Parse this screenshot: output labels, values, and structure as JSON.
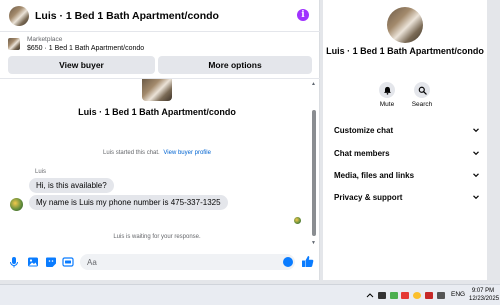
{
  "header": {
    "title": "Luis · 1 Bed 1 Bath Apartment/condo",
    "info_icon": "info-icon",
    "info_glyph": "i"
  },
  "marketplace": {
    "label": "Marketplace",
    "listing": "$650 · 1 Bed 1 Bath Apartment/condo"
  },
  "actions": {
    "view_buyer": "View buyer",
    "more_options": "More options"
  },
  "thread": {
    "title": "Luis · 1 Bed 1 Bath Apartment/condo",
    "started_text": "Luis started this chat.",
    "started_link": "View buyer profile",
    "sender_name": "Luis",
    "messages": [
      "Hi, is this available?",
      "My name is Luis my phone number is 475-337-1325"
    ],
    "waiting_text": "Luis is waiting for your response."
  },
  "composer": {
    "placeholder": "Aa",
    "icons": [
      "microphone-icon",
      "image-icon",
      "sticker-icon",
      "gif-icon",
      "emoji-icon",
      "like-icon"
    ],
    "accent": "#0a7cff"
  },
  "panel": {
    "title": "Luis · 1 Bed 1 Bath Apartment/condo",
    "mute_label": "Mute",
    "search_label": "Search",
    "sections": [
      "Customize chat",
      "Chat members",
      "Media, files and links",
      "Privacy & support"
    ]
  },
  "taskbar": {
    "language": "ENG",
    "time": "9:07 PM",
    "date": "12/23/2025"
  },
  "colors": {
    "info_purple": "#a033ff",
    "link_blue": "#0064d1"
  }
}
